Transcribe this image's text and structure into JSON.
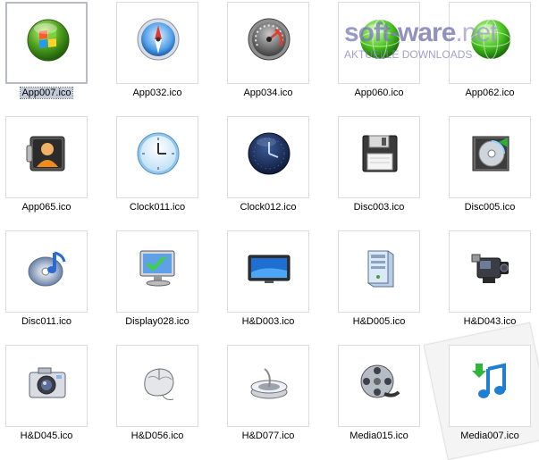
{
  "watermark": {
    "title_part1": "soft",
    "title_dash": "-",
    "title_part2": "ware",
    "title_part3": ".net",
    "subtitle": "AKTUELLE DOWNLOADS"
  },
  "files": [
    {
      "name": "App007.ico",
      "icon": "windows-orb-icon",
      "selected": true
    },
    {
      "name": "App032.ico",
      "icon": "compass-icon",
      "selected": false
    },
    {
      "name": "App034.ico",
      "icon": "gauge-icon",
      "selected": false
    },
    {
      "name": "App060.ico",
      "icon": "green-globe-icon",
      "selected": false
    },
    {
      "name": "App062.ico",
      "icon": "green-globe-icon",
      "selected": false
    },
    {
      "name": "App065.ico",
      "icon": "user-card-icon",
      "selected": false
    },
    {
      "name": "Clock011.ico",
      "icon": "clock-icon",
      "selected": false
    },
    {
      "name": "Clock012.ico",
      "icon": "dark-clock-icon",
      "selected": false
    },
    {
      "name": "Disc003.ico",
      "icon": "floppy-disk-icon",
      "selected": false
    },
    {
      "name": "Disc005.ico",
      "icon": "cd-case-icon",
      "selected": false
    },
    {
      "name": "Disc011.ico",
      "icon": "music-disc-icon",
      "selected": false
    },
    {
      "name": "Display028.ico",
      "icon": "monitor-check-icon",
      "selected": false
    },
    {
      "name": "H&D003.ico",
      "icon": "flat-screen-icon",
      "selected": false
    },
    {
      "name": "H&D005.ico",
      "icon": "server-tower-icon",
      "selected": false
    },
    {
      "name": "H&D043.ico",
      "icon": "camcorder-icon",
      "selected": false
    },
    {
      "name": "H&D045.ico",
      "icon": "camera-icon",
      "selected": false
    },
    {
      "name": "H&D056.ico",
      "icon": "mouse-icon",
      "selected": false
    },
    {
      "name": "H&D077.ico",
      "icon": "webcam-icon",
      "selected": false
    },
    {
      "name": "Media015.ico",
      "icon": "film-reel-icon",
      "selected": false
    },
    {
      "name": "Media007.ico",
      "icon": "music-note-icon",
      "selected": false
    }
  ]
}
